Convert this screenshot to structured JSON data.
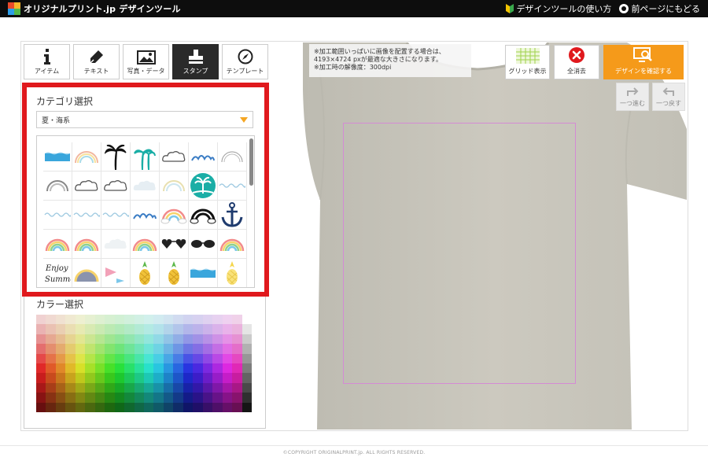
{
  "header": {
    "logo_text": "オリジナルプリント.jp デザインツール",
    "link_howto": "デザインツールの使い方",
    "link_back": "前ページにもどる"
  },
  "tabs": [
    {
      "label": "アイテム",
      "icon": "info-icon",
      "active": false
    },
    {
      "label": "テキスト",
      "icon": "pen-icon",
      "active": false
    },
    {
      "label": "写真・データ",
      "icon": "image-icon",
      "active": false
    },
    {
      "label": "スタンプ",
      "icon": "stamp-icon",
      "active": true
    },
    {
      "label": "テンプレート",
      "icon": "template-icon",
      "active": false
    }
  ],
  "category": {
    "title": "カテゴリ選択",
    "selected": "夏・海系"
  },
  "stamps": {
    "items": [
      "wave-strip",
      "rainbow-arc",
      "palm-tree-black",
      "palm-tree-teal",
      "cloud-outline",
      "waves-blue",
      "rainbow-thin",
      "rainbow-grey",
      "cloud-outline",
      "cloud-outline",
      "cloud-soft",
      "rainbow-faint",
      "island-circle",
      "wave-line",
      "wave-line",
      "wave-line",
      "wave-line",
      "waves-blue",
      "rainbow-cloud",
      "rainbow-black",
      "anchor",
      "rainbow",
      "rainbow",
      "cloud-faint",
      "rainbow",
      "heart-sunglasses",
      "sunglasses",
      "rainbow",
      "enjoy-summer",
      "rainbow-dome",
      "pennant",
      "pineapple",
      "pineapple",
      "wave-strip",
      "pineapple-yellow"
    ]
  },
  "color": {
    "title": "カラー選択"
  },
  "canvas": {
    "info_lines": [
      "※加工範囲いっぱいに画像を配置する場合は、",
      "4193×4724 pxが最適な大きさになります。",
      "※加工時の解像度：300dpi"
    ]
  },
  "toolbar": {
    "grid_label": "グリッド表示",
    "clear_label": "全消去",
    "confirm_label": "デザインを確認する",
    "redo_label": "一つ進む",
    "undo_label": "一つ戻す"
  },
  "footer": {
    "copyright": "©COPYRIGHT ORIGINALPRINT.jp. ALL RIGHTS RESERVED."
  },
  "colors": {
    "highlight": "#e0191d",
    "accent": "#f59a1a",
    "shirt": "#c9c7bd",
    "print_area": "#d48bd4"
  }
}
